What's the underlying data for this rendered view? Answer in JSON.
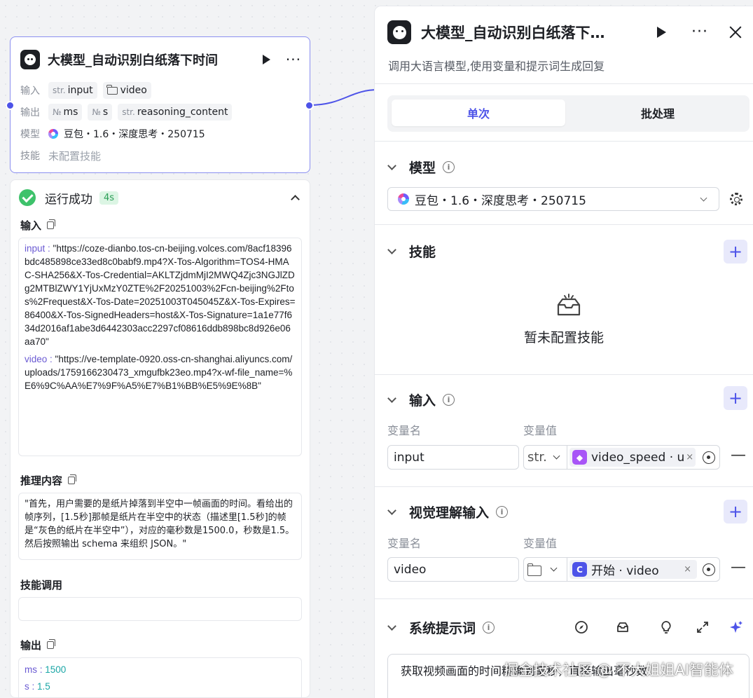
{
  "node": {
    "title": "大模型_自动识别白纸落下时间",
    "input_label": "输入",
    "output_label": "输出",
    "model_label": "模型",
    "skill_label": "技能",
    "inputs": [
      {
        "type": "str.",
        "name": "input"
      },
      {
        "type": "folder-icon",
        "name": "video"
      }
    ],
    "outputs": [
      {
        "type": "№",
        "name": "ms"
      },
      {
        "type": "№",
        "name": "s"
      },
      {
        "type": "str.",
        "name": "reasoning_content"
      }
    ],
    "model": "豆包・1.6・深度思考・250715",
    "skill": "未配置技能"
  },
  "result": {
    "status": "运行成功",
    "duration": "4s",
    "input_title": "输入",
    "input_key": "input",
    "input_value": "\"https://coze-dianbo.tos-cn-beijing.volces.com/8acf18396bdc485898ce33ed8c0babf9.mp4?X-Tos-Algorithm=TOS4-HMAC-SHA256&X-Tos-Credential=AKLTZjdmMjI2MWQ4Zjc3NGJlZDg2MTBlZWY1YjUxMzY0ZTE%2F20251003%2Fcn-beijing%2Ftos%2Frequest&X-Tos-Date=20251003T045045Z&X-Tos-Expires=86400&X-Tos-SignedHeaders=host&X-Tos-Signature=1a1e77f634d2016af1abe3d6442303acc2297cf08616ddb898bc8d926e06aa70\"",
    "video_key": "video",
    "video_value": "\"https://ve-template-0920.oss-cn-shanghai.aliyuncs.com/uploads/1759166230473_xmgufbk23eo.mp4?x-wf-file_name=%E6%9C%AA%E7%9F%A5%E7%B1%BB%E5%9E%8B\"",
    "reasoning_title": "推理内容",
    "reasoning_text": "\"首先，用户需要的是纸片掉落到半空中一帧画面的时间。看给出的帧序列，[1.5秒]那帧是纸片在半空中的状态（描述里[1.5秒]的帧是“灰色的纸片在半空中”），对应的毫秒数是1500.0，秒数是1.5。然后按照输出 schema 来组织 JSON。\"",
    "skill_call_title": "技能调用",
    "output_title": "输出",
    "out_ms_key": "ms",
    "out_ms_val": "1500",
    "out_s_key": "s",
    "out_s_val": "1.5"
  },
  "panel": {
    "title": "大模型_自动识别白纸落下…",
    "description": "调用大语言模型,使用变量和提示词生成回复",
    "tab_single": "单次",
    "tab_batch": "批处理",
    "model_section": "模型",
    "model_value": "豆包・1.6・深度思考・250715",
    "skill_section": "技能",
    "skill_empty": "暂未配置技能",
    "input_section": "输入",
    "var_name_label": "变量名",
    "var_value_label": "变量值",
    "input_var_name": "input",
    "input_var_type": "str.",
    "input_var_ref": "video_speed · u",
    "vision_section": "视觉理解输入",
    "vision_var_name": "video",
    "vision_var_ref": "开始 · video",
    "system_prompt_section": "系统提示词",
    "system_prompt_text": "获取视频画面的时间精确到毫秒，直接输出毫秒数"
  },
  "watermark": "掘金技术社区 @ 不大姐姐AI智能体",
  "colors": {
    "accent": "#4d53e8",
    "success": "#3ec26b",
    "node_border": "#8b8ff0"
  }
}
